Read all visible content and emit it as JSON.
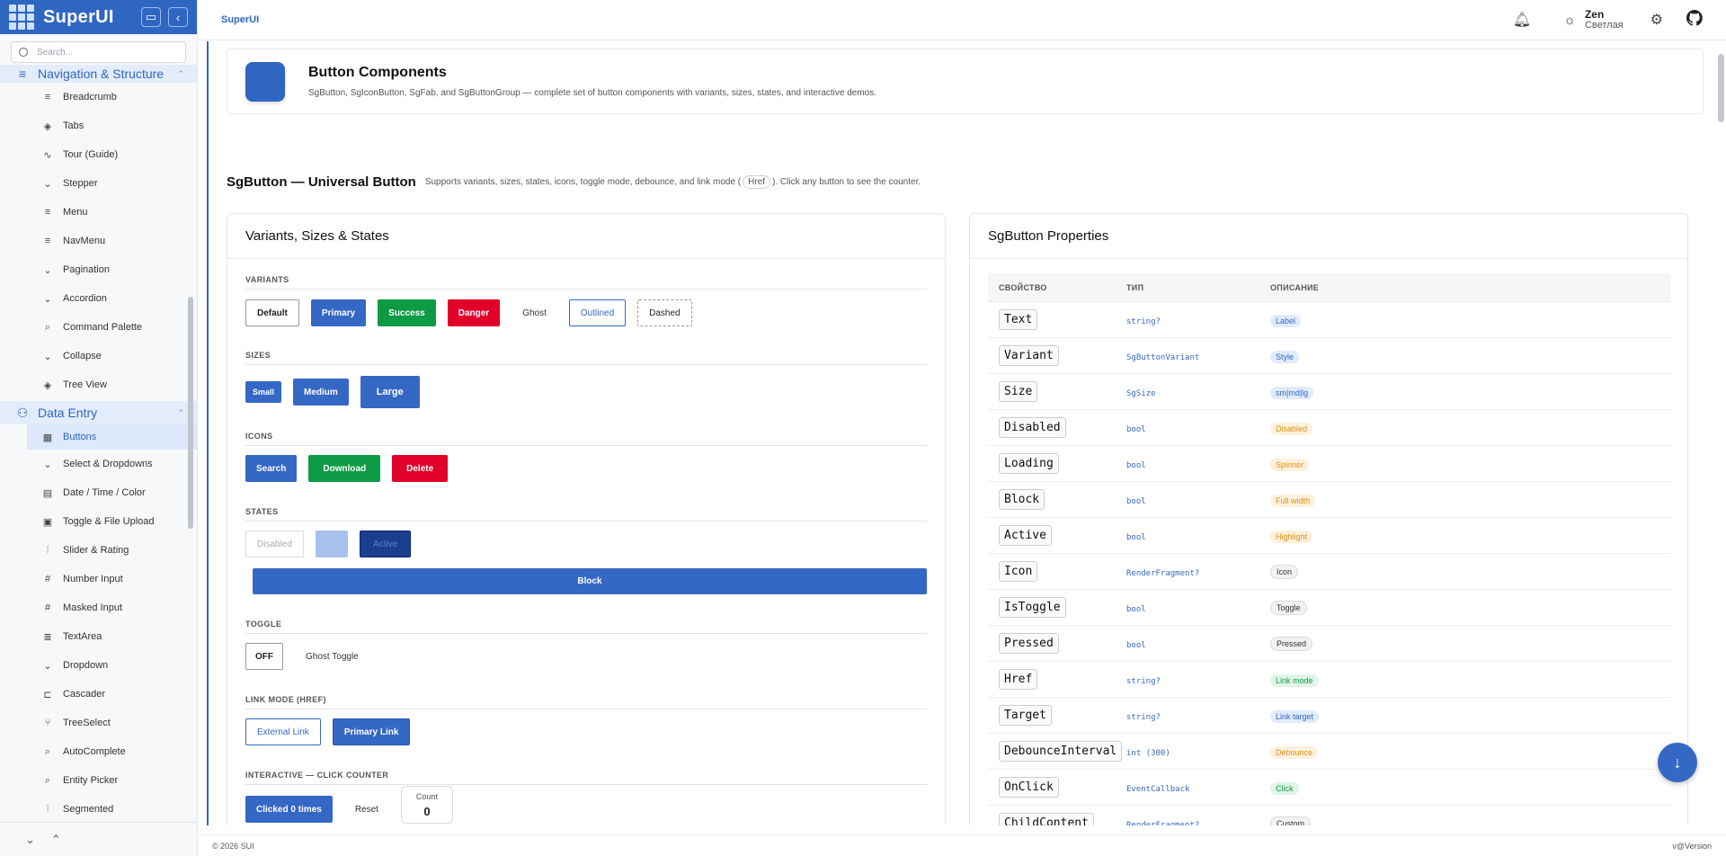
{
  "sidebar": {
    "brand": "SuperUI",
    "search_placeholder": "Search...",
    "group_nav": "Navigation & Structure",
    "nav_items": [
      {
        "label": "Breadcrumb",
        "icon": "≡"
      },
      {
        "label": "Tabs",
        "icon": "◈"
      },
      {
        "label": "Tour (Guide)",
        "icon": "∿"
      },
      {
        "label": "Stepper",
        "icon": "⌄"
      },
      {
        "label": "Menu",
        "icon": "≡"
      },
      {
        "label": "NavMenu",
        "icon": "≡"
      },
      {
        "label": "Pagination",
        "icon": "⌄"
      },
      {
        "label": "Accordion",
        "icon": "⌄"
      },
      {
        "label": "Command Palette",
        "icon": "⌕"
      },
      {
        "label": "Collapse",
        "icon": "⌄"
      },
      {
        "label": "Tree View",
        "icon": "◈"
      }
    ],
    "group_data": "Data Entry",
    "data_items": [
      {
        "label": "Buttons",
        "icon": "▦",
        "active": true
      },
      {
        "label": "Select & Dropdowns",
        "icon": "⌄"
      },
      {
        "label": "Date / Time / Color",
        "icon": "▤"
      },
      {
        "label": "Toggle & File Upload",
        "icon": "▣"
      },
      {
        "label": "Slider & Rating",
        "icon": "⫶"
      },
      {
        "label": "Number Input",
        "icon": "#"
      },
      {
        "label": "Masked Input",
        "icon": "#"
      },
      {
        "label": "TextArea",
        "icon": "≣"
      },
      {
        "label": "Dropdown",
        "icon": "⌄"
      },
      {
        "label": "Cascader",
        "icon": "⊏"
      },
      {
        "label": "TreeSelect",
        "icon": "⑂"
      },
      {
        "label": "AutoComplete",
        "icon": "⌕"
      },
      {
        "label": "Entity Picker",
        "icon": "⌕"
      },
      {
        "label": "Segmented",
        "icon": "⫶"
      }
    ]
  },
  "header": {
    "breadcrumb": "SuperUI",
    "theme_name": "Zen",
    "theme_mode": "Светлая"
  },
  "banner": {
    "title": "Button Components",
    "desc": "SgButton, SgIconButton, SgFab, and SgButtonGroup — complete set of button components with variants, sizes, states, and interactive demos."
  },
  "section": {
    "title": "SgButton — Universal Button",
    "desc_a": "Supports variants, sizes, states, icons, toggle mode, debounce, and link mode (",
    "href": "Href",
    "desc_b": "). Click any button to see the counter."
  },
  "demo": {
    "title": "Variants, Sizes & States",
    "variants_label": "VARIANTS",
    "variants": [
      "Default",
      "Primary",
      "Success",
      "Danger",
      "Ghost",
      "Outlined",
      "Dashed"
    ],
    "sizes_label": "SIZES",
    "sizes": [
      "Small",
      "Medium",
      "Large"
    ],
    "icons_label": "ICONS",
    "icons": [
      "Search",
      "Download",
      "Delete"
    ],
    "states_label": "STATES",
    "disabled": "Disabled",
    "active": "Active",
    "block": "Block",
    "toggle_label": "TOGGLE",
    "toggle_off": "OFF",
    "ghost_toggle": "Ghost Toggle",
    "link_label": "LINK MODE (HREF)",
    "external_link": "External Link",
    "primary_link": "Primary Link",
    "counter_label": "INTERACTIVE — CLICK COUNTER",
    "clicked": "Clicked 0 times",
    "reset": "Reset",
    "count_label": "Count",
    "count_value": "0"
  },
  "props": {
    "title": "SgButton Properties",
    "headers": [
      "СВОЙСТВО",
      "ТИП",
      "ОПИСАНИЕ"
    ],
    "rows": [
      {
        "name": "Text",
        "type": "string?",
        "desc": "Label",
        "tone": "blue"
      },
      {
        "name": "Variant",
        "type": "SgButtonVariant",
        "desc": "Style",
        "tone": "blue"
      },
      {
        "name": "Size",
        "type": "SgSize",
        "desc": "sm|md|lg",
        "tone": "blue"
      },
      {
        "name": "Disabled",
        "type": "bool",
        "desc": "Disabled",
        "tone": "orange"
      },
      {
        "name": "Loading",
        "type": "bool",
        "desc": "Spinner",
        "tone": "orange"
      },
      {
        "name": "Block",
        "type": "bool",
        "desc": "Full width",
        "tone": "orange"
      },
      {
        "name": "Active",
        "type": "bool",
        "desc": "Highlight",
        "tone": "orange"
      },
      {
        "name": "Icon",
        "type": "RenderFragment?",
        "desc": "Icon",
        "tone": "gray"
      },
      {
        "name": "IsToggle",
        "type": "bool",
        "desc": "Toggle",
        "tone": "gray"
      },
      {
        "name": "Pressed",
        "type": "bool",
        "desc": "Pressed",
        "tone": "gray"
      },
      {
        "name": "Href",
        "type": "string?",
        "desc": "Link mode",
        "tone": "green"
      },
      {
        "name": "Target",
        "type": "string?",
        "desc": "Link target",
        "tone": "blue"
      },
      {
        "name": "DebounceInterval",
        "type": "int (300)",
        "desc": "Debounce",
        "tone": "orange"
      },
      {
        "name": "OnClick",
        "type": "EventCallback",
        "desc": "Click",
        "tone": "green"
      },
      {
        "name": "ChildContent",
        "type": "RenderFragment?",
        "desc": "Custom",
        "tone": "gray"
      }
    ]
  },
  "footer": {
    "copyright": "© 2026 SUI",
    "version": "v@Version"
  }
}
